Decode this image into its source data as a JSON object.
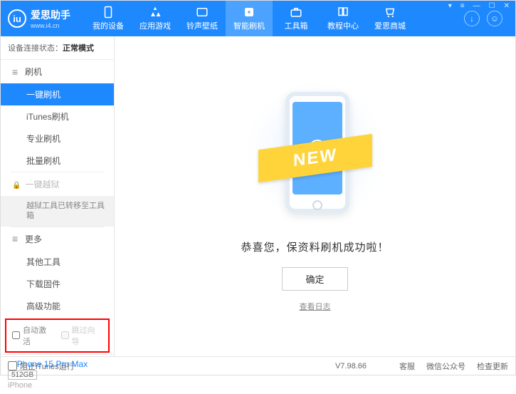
{
  "logo": {
    "glyph": "iu",
    "title": "爱思助手",
    "url": "www.i4.cn"
  },
  "nav": {
    "items": [
      {
        "label": "我的设备"
      },
      {
        "label": "应用游戏"
      },
      {
        "label": "铃声壁纸"
      },
      {
        "label": "智能刷机"
      },
      {
        "label": "工具箱"
      },
      {
        "label": "教程中心"
      },
      {
        "label": "爱思商城"
      }
    ]
  },
  "status": {
    "label": "设备连接状态：",
    "value": "正常模式"
  },
  "sidebar": {
    "group_flash": "刷机",
    "items_flash": [
      "一键刷机",
      "iTunes刷机",
      "专业刷机",
      "批量刷机"
    ],
    "group_jailbreak": "一键越狱",
    "jailbreak_note": "越狱工具已转移至工具箱",
    "group_more": "更多",
    "items_more": [
      "其他工具",
      "下载固件",
      "高级功能"
    ],
    "auto_activate": "自动激活",
    "skip_guide": "跳过向导"
  },
  "device": {
    "name": "iPhone 15 Pro Max",
    "storage": "512GB",
    "type": "iPhone"
  },
  "main": {
    "ribbon": "NEW",
    "success": "恭喜您，保资料刷机成功啦！",
    "confirm": "确定",
    "log": "查看日志"
  },
  "footer": {
    "block_itunes": "阻止iTunes运行",
    "version": "V7.98.66",
    "links": [
      "客服",
      "微信公众号",
      "检查更新"
    ]
  }
}
